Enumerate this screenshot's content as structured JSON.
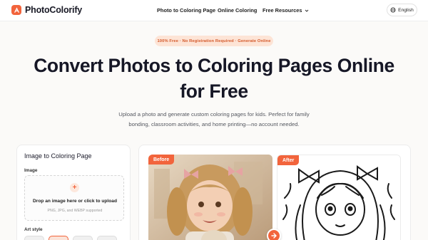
{
  "header": {
    "brand": "PhotoColorify",
    "nav": [
      "Photo to Coloring Page",
      "Online Coloring",
      "Free Resources"
    ],
    "language": "English"
  },
  "hero": {
    "badge": "100% Free · No Registration Required · Generate Online",
    "title_line1": "Convert Photos to Coloring Pages Online",
    "title_line2": "for Free",
    "subtitle_line1": "Upload a photo and generate custom coloring pages for kids. Perfect for family",
    "subtitle_line2": "bonding, classroom activities, and home printing—no account needed."
  },
  "tool": {
    "title": "Image to Coloring Page",
    "image_label": "Image",
    "drop_text": "Drop an image here or click to upload",
    "drop_hint": "PNG, JPG, and WEBP supported",
    "art_style_label": "Art style"
  },
  "preview": {
    "before_label": "Before",
    "after_label": "After"
  },
  "colors": {
    "accent": "#f2643c",
    "badge_bg": "#fde4d6",
    "heading": "#161726"
  }
}
